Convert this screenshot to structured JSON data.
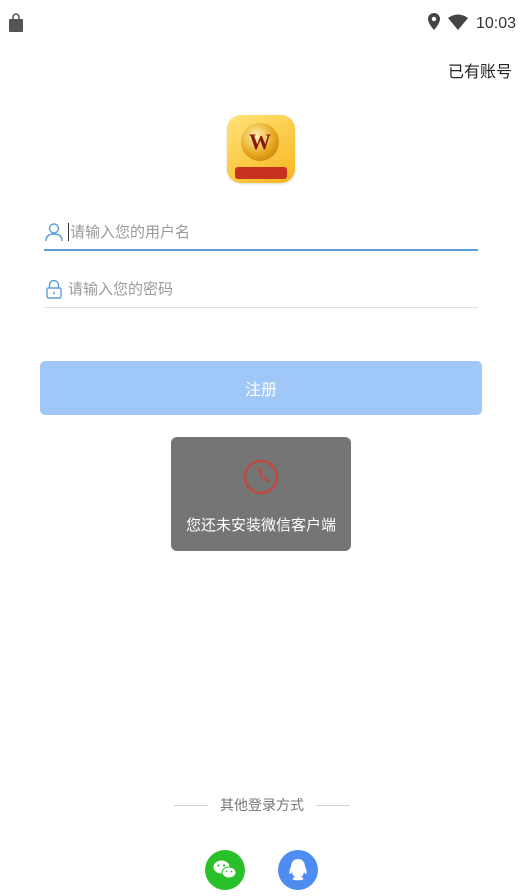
{
  "status_bar": {
    "time": "10:03"
  },
  "header": {
    "link": "已有账号"
  },
  "form": {
    "username_placeholder": "请输入您的用户名",
    "password_placeholder": "请输入您的密码",
    "register_button": "注册"
  },
  "toast": {
    "message": "您还未安装微信客户端"
  },
  "other_login": {
    "label": "其他登录方式"
  },
  "colors": {
    "primary_button": "#9fc7f7",
    "input_focus": "#5b9ee0",
    "wechat": "#2ac02a",
    "qq": "#4d8df0",
    "toast_bg": "#757575"
  }
}
